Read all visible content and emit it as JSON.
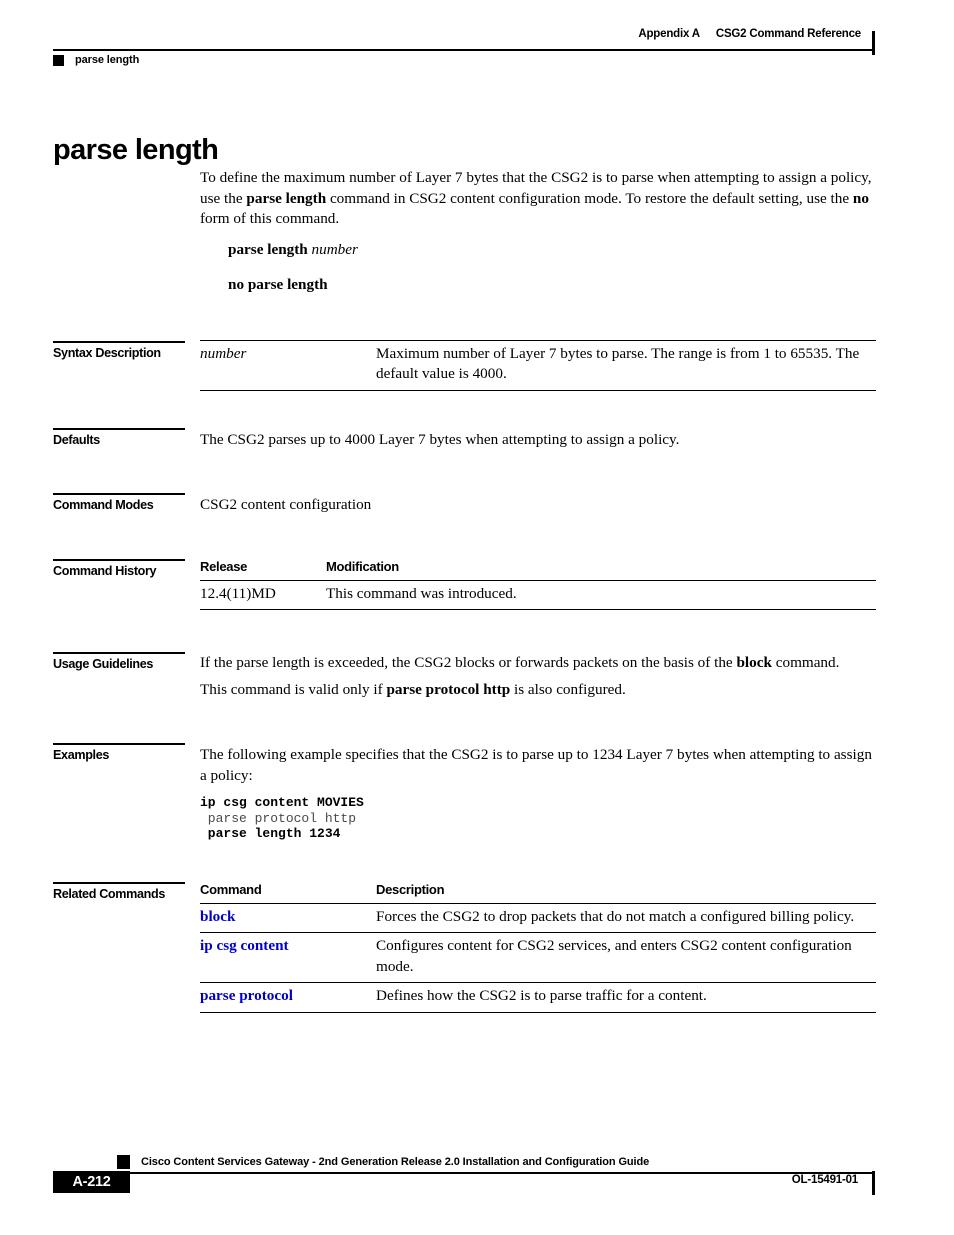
{
  "header": {
    "appendix": "Appendix A",
    "chapter": "CSG2 Command Reference",
    "running_command": "parse length"
  },
  "title": "parse length",
  "intro": {
    "part1": "To define the maximum number of Layer 7 bytes that the CSG2 is to parse when attempting to assign a policy, use the ",
    "bold1": "parse length",
    "part2": " command in CSG2 content configuration mode. To restore the default setting, use the ",
    "bold2": "no",
    "part3": " form of this command."
  },
  "syntax_lines": {
    "line1_bold": "parse length",
    "line1_italic": " number",
    "line2_bold": "no parse length"
  },
  "sections": {
    "syntax_description": "Syntax Description",
    "defaults": "Defaults",
    "command_modes": "Command Modes",
    "command_history": "Command History",
    "usage_guidelines": "Usage Guidelines",
    "examples": "Examples",
    "related_commands": "Related Commands"
  },
  "syntax_table": {
    "rows": [
      {
        "argument": "number",
        "description": "Maximum number of Layer 7 bytes to parse. The range is from 1 to 65535. The default value is 4000."
      }
    ]
  },
  "defaults_text": "The CSG2 parses up to 4000 Layer 7 bytes when attempting to assign a policy.",
  "command_modes_text": "CSG2 content configuration",
  "command_history": {
    "headers": [
      "Release",
      "Modification"
    ],
    "rows": [
      {
        "release": "12.4(11)MD",
        "modification": "This command was introduced."
      }
    ]
  },
  "usage_guidelines": {
    "para1_part1": "If the parse length is exceeded, the CSG2 blocks or forwards packets on the basis of the ",
    "para1_bold": "block",
    "para1_part2": " command.",
    "para2_part1": "This command is valid only if ",
    "para2_bold": "parse protocol http",
    "para2_part2": " is also configured."
  },
  "examples": {
    "intro": "The following example specifies that the CSG2 is to parse up to 1234 Layer 7 bytes when attempting to assign a policy:",
    "code_lines": [
      {
        "text": "ip csg content MOVIES",
        "bold": true
      },
      {
        "text": " parse protocol http",
        "bold": false
      },
      {
        "text": " parse length 1234",
        "bold": true
      }
    ]
  },
  "related_commands": {
    "headers": [
      "Command",
      "Description"
    ],
    "rows": [
      {
        "command": "block",
        "description": "Forces the CSG2 to drop packets that do not match a configured billing policy."
      },
      {
        "command": "ip csg content",
        "description": "Configures content for CSG2 services, and enters CSG2 content configuration mode."
      },
      {
        "command": "parse protocol",
        "description": "Defines how the CSG2 is to parse traffic for a content."
      }
    ]
  },
  "footer": {
    "guide_title": "Cisco Content Services Gateway - 2nd Generation Release 2.0 Installation and Configuration Guide",
    "page_number": "A-212",
    "doc_id": "OL-15491-01"
  },
  "colors": {
    "link_blue": "#0000cc",
    "rule_black": "#000000"
  }
}
